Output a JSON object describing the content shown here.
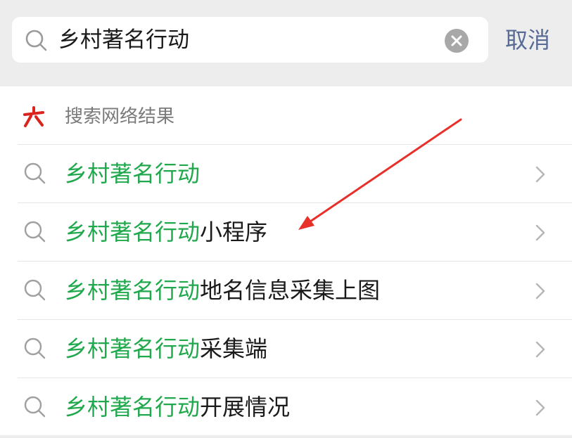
{
  "search": {
    "query": "乡村著名行动",
    "cancel_label": "取消"
  },
  "section": {
    "title": "搜索网络结果"
  },
  "results": [
    {
      "highlight": "乡村著名行动",
      "rest": ""
    },
    {
      "highlight": "乡村著名行动",
      "rest": "小程序"
    },
    {
      "highlight": "乡村著名行动",
      "rest": "地名信息采集上图"
    },
    {
      "highlight": "乡村著名行动",
      "rest": "采集端"
    },
    {
      "highlight": "乡村著名行动",
      "rest": "开展情况"
    }
  ],
  "colors": {
    "accent_green": "#20a84c",
    "link_blue": "#576b95",
    "annotation_arrow": "#e8302a",
    "brand_red": "#d9251d"
  },
  "icons": {
    "search": "search-icon",
    "clear": "clear-icon",
    "brand": "brand-icon",
    "chevron": "chevron-right-icon"
  }
}
